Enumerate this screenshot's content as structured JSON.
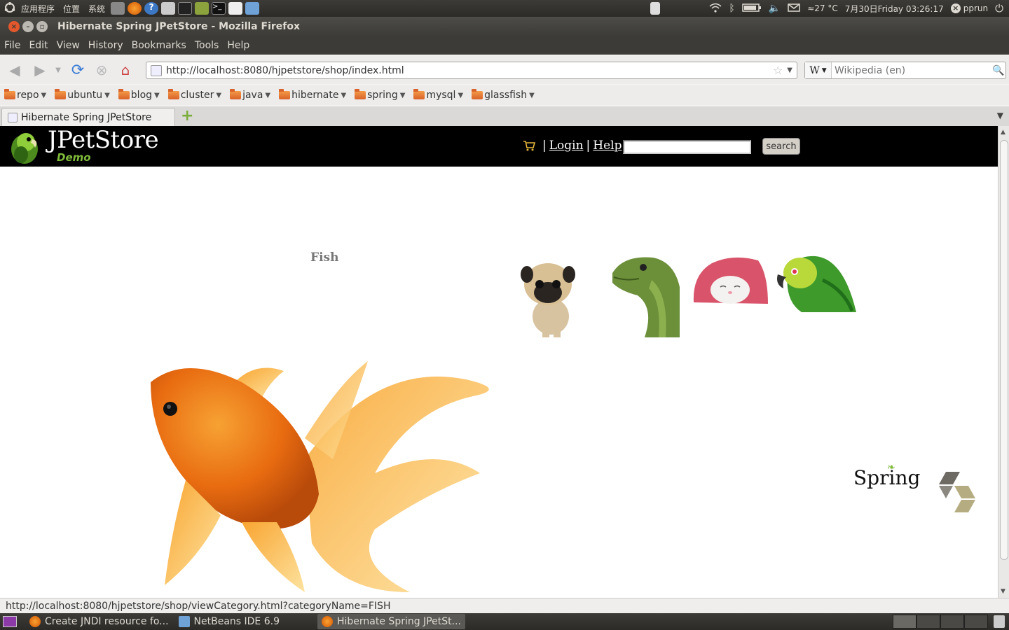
{
  "top_panel": {
    "apps_menu": "应用程序",
    "places_menu": "位置",
    "system_menu": "系统",
    "weather": "≈27 °C",
    "clock": "7月30日Friday 03:26:17",
    "user": "pprun"
  },
  "window": {
    "title": "Hibernate Spring JPetStore - Mozilla Firefox"
  },
  "menubar": {
    "items": [
      "File",
      "Edit",
      "View",
      "History",
      "Bookmarks",
      "Tools",
      "Help"
    ]
  },
  "navbar": {
    "url": "http://localhost:8080/hjpetstore/shop/index.html",
    "search_engine": "W",
    "search_placeholder": "Wikipedia (en)"
  },
  "bookmarks": [
    "repo",
    "ubuntu",
    "blog",
    "cluster",
    "java",
    "hibernate",
    "spring",
    "mysql",
    "glassfish"
  ],
  "tabs": [
    {
      "label": "Hibernate Spring JPetStore"
    }
  ],
  "page": {
    "logo_text": "JPetStore",
    "logo_sub": "Demo",
    "separator1": "|",
    "login_link": "Login",
    "separator2": "|",
    "help_link": "Help",
    "search_button": "search",
    "category_title": "Fish",
    "spring_logo": "Spring"
  },
  "status": {
    "text": "http://localhost:8080/hjpetstore/shop/viewCategory.html?categoryName=FISH"
  },
  "taskbar": {
    "tasks": [
      {
        "label": "Create JNDI resource fo..."
      },
      {
        "label": "NetBeans IDE 6.9"
      },
      {
        "label": "Hibernate Spring JPetSt..."
      }
    ]
  },
  "colors": {
    "header_bg": "#000000",
    "logo_green": "#7fba3a",
    "category_title": "#777777"
  }
}
